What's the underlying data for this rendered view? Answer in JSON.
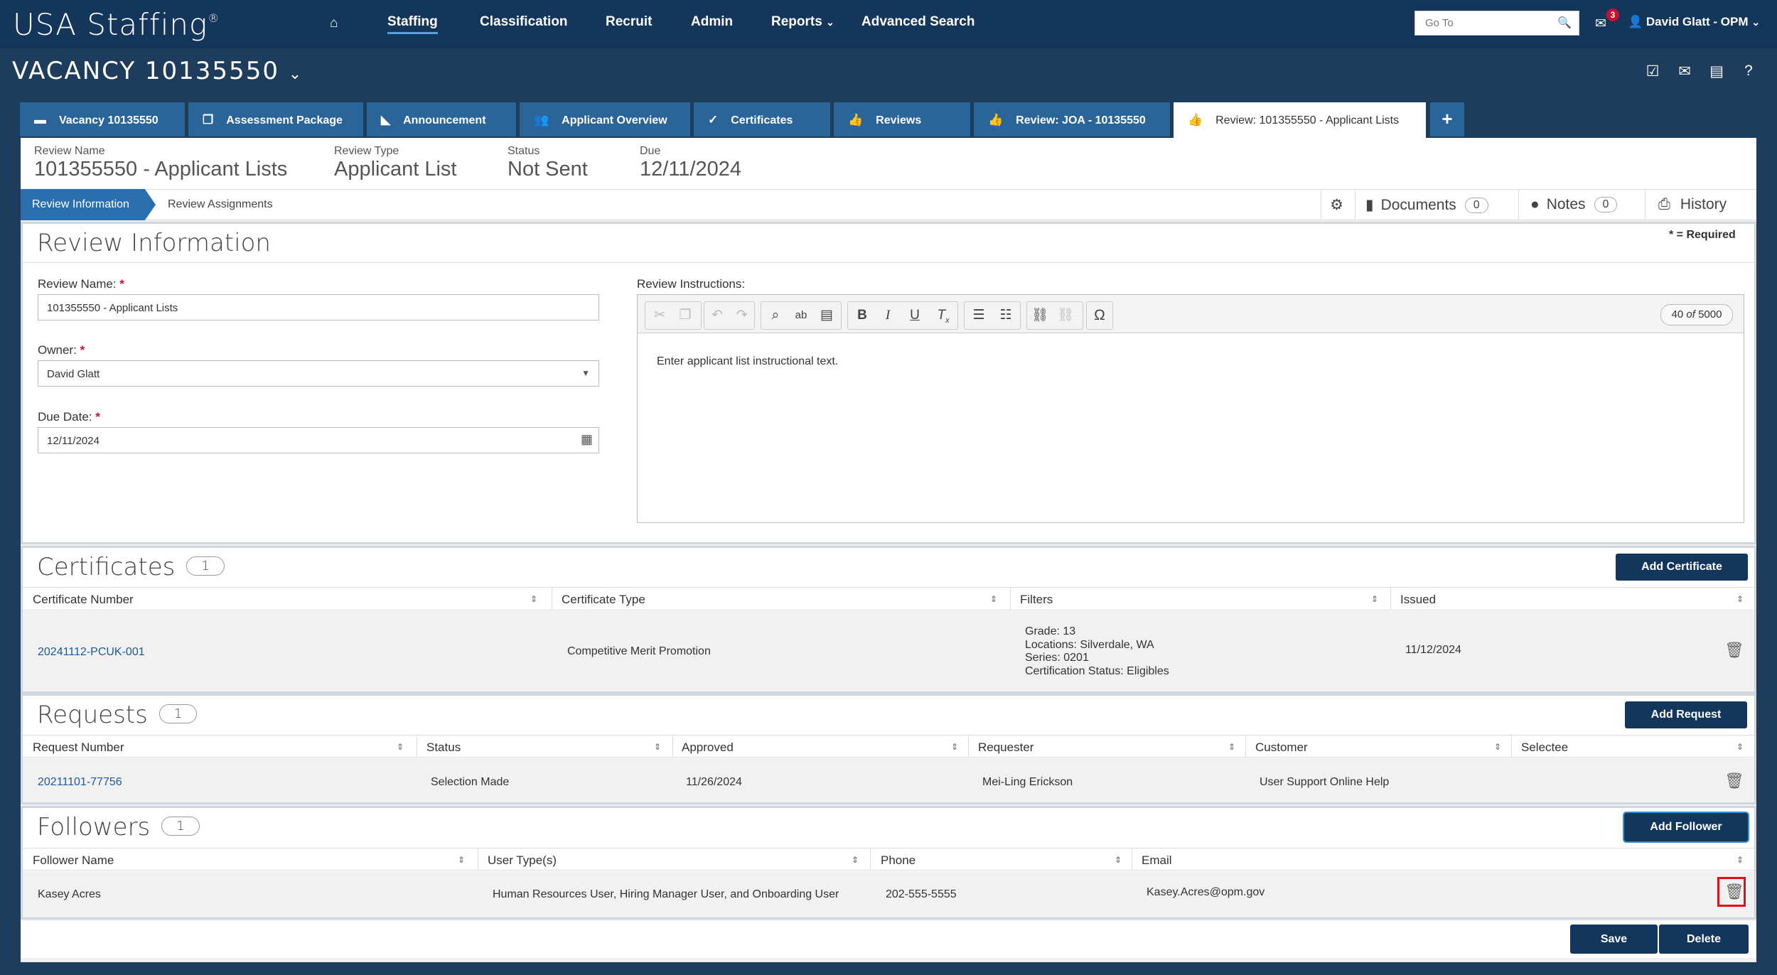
{
  "app": {
    "logo": "USA Staffing",
    "logo_mark": "®"
  },
  "nav": {
    "items": [
      "Staffing",
      "Classification",
      "Recruit",
      "Admin",
      "Reports",
      "Advanced Search"
    ],
    "goto_placeholder": "Go To",
    "mail_count": "3",
    "user": "David Glatt - OPM"
  },
  "vacancy": {
    "title": "VACANCY 10135550"
  },
  "tabs": [
    "Vacancy 10135550",
    "Assessment Package",
    "Announcement",
    "Applicant Overview",
    "Certificates",
    "Reviews",
    "Review: JOA - 10135550",
    "Review: 101355550 - Applicant Lists"
  ],
  "summary": {
    "name_label": "Review Name",
    "name": "101355550 - Applicant Lists",
    "type_label": "Review Type",
    "type": "Applicant List",
    "status_label": "Status",
    "status": "Not Sent",
    "due_label": "Due",
    "due": "12/11/2024"
  },
  "subnav": {
    "active": "Review Information",
    "assign": "Review Assignments",
    "documents": "Documents",
    "documents_count": "0",
    "notes": "Notes",
    "notes_count": "0",
    "history": "History"
  },
  "review": {
    "title": "Review Information",
    "required_note": "* = Required",
    "name_label": "Review Name:",
    "name_value": "101355550 - Applicant Lists",
    "owner_label": "Owner:",
    "owner_value": "David Glatt",
    "due_label": "Due Date:",
    "due_value": "12/11/2024",
    "instructions_label": "Review Instructions:",
    "char_count": "40",
    "char_of": "of",
    "char_max": "5000",
    "instructions_text": "Enter applicant list instructional text."
  },
  "certificates": {
    "title": "Certificates",
    "count": "1",
    "add_label": "Add Certificate",
    "headers": [
      "Certificate Number",
      "Certificate Type",
      "Filters",
      "Issued"
    ],
    "row": {
      "number": "20241112-PCUK-001",
      "type": "Competitive Merit Promotion",
      "filters": [
        "Grade: 13",
        "Locations: Silverdale, WA",
        "Series: 0201",
        "Certification Status: Eligibles"
      ],
      "issued": "11/12/2024"
    }
  },
  "requests": {
    "title": "Requests",
    "count": "1",
    "add_label": "Add Request",
    "headers": [
      "Request Number",
      "Status",
      "Approved",
      "Requester",
      "Customer",
      "Selectee"
    ],
    "row": {
      "number": "20211101-77756",
      "status": "Selection Made",
      "approved": "11/26/2024",
      "requester": "Mei-Ling Erickson",
      "customer": "User Support Online Help",
      "selectee": ""
    }
  },
  "followers": {
    "title": "Followers",
    "count": "1",
    "add_label": "Add Follower",
    "headers": [
      "Follower Name",
      "User Type(s)",
      "Phone",
      "Email"
    ],
    "row": {
      "name": "Kasey Acres",
      "types": "Human Resources User, Hiring Manager User, and Onboarding User",
      "phone": "202-555-5555",
      "email": "Kasey.Acres@opm.gov"
    }
  },
  "actions": {
    "save": "Save",
    "delete": "Delete"
  },
  "colors": {
    "nav": "#14365a",
    "accent": "#2a6fb0",
    "button": "#13365c",
    "highlight": "#e0101a"
  }
}
